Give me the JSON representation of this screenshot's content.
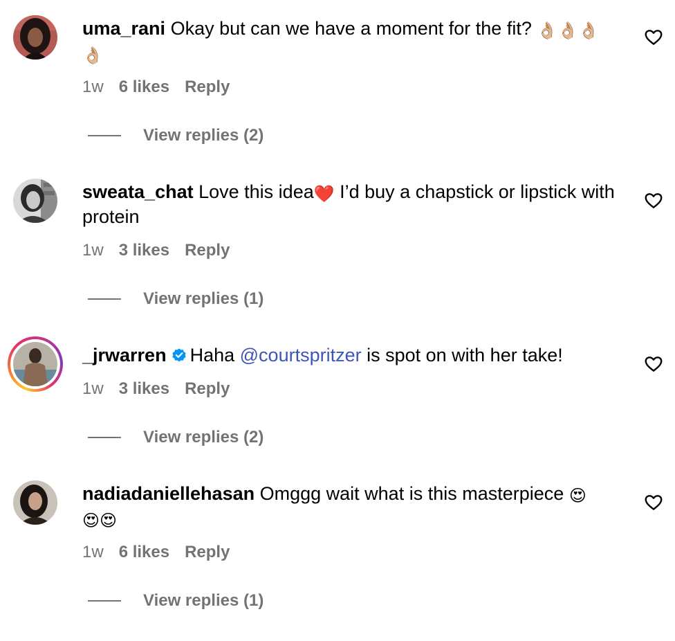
{
  "comments": [
    {
      "username": "uma_rani",
      "text": "Okay but can we have a moment for the fit?",
      "emojis": "👌🏼👌🏼👌🏼",
      "emojis_line2": "👌🏼",
      "time": "1w",
      "likes": "6 likes",
      "reply_label": "Reply",
      "view_replies": "View replies (2)",
      "avatar_icon": "profile-photo",
      "like_icon": "heart-outline-icon"
    },
    {
      "username": "sweata_chat",
      "text_before": "Love this idea",
      "emoji": "❤️",
      "text_after": " I’d buy a chapstick or lipstick with protein",
      "time": "1w",
      "likes": "3 likes",
      "reply_label": "Reply",
      "view_replies": "View replies (1)",
      "avatar_icon": "profile-photo",
      "like_icon": "heart-outline-icon"
    },
    {
      "username": "_jrwarren",
      "verified": true,
      "text_before": "Haha ",
      "mention": "@courtspritzer",
      "text_after": " is spot on with her take!",
      "time": "1w",
      "likes": "3 likes",
      "reply_label": "Reply",
      "view_replies": "View replies (2)",
      "avatar_icon": "profile-photo-story-ring",
      "like_icon": "heart-outline-icon"
    },
    {
      "username": "nadiadaniellehasan",
      "text": "Omggg wait what is this masterpiece",
      "emojis": "😍",
      "emojis_line2": "😍😍",
      "time": "1w",
      "likes": "6 likes",
      "reply_label": "Reply",
      "view_replies": "View replies (1)",
      "avatar_icon": "profile-photo",
      "like_icon": "heart-outline-icon"
    }
  ],
  "colors": {
    "secondary_text": "#737373",
    "mention": "#3d55b8",
    "verified_badge": "#0095f6"
  }
}
